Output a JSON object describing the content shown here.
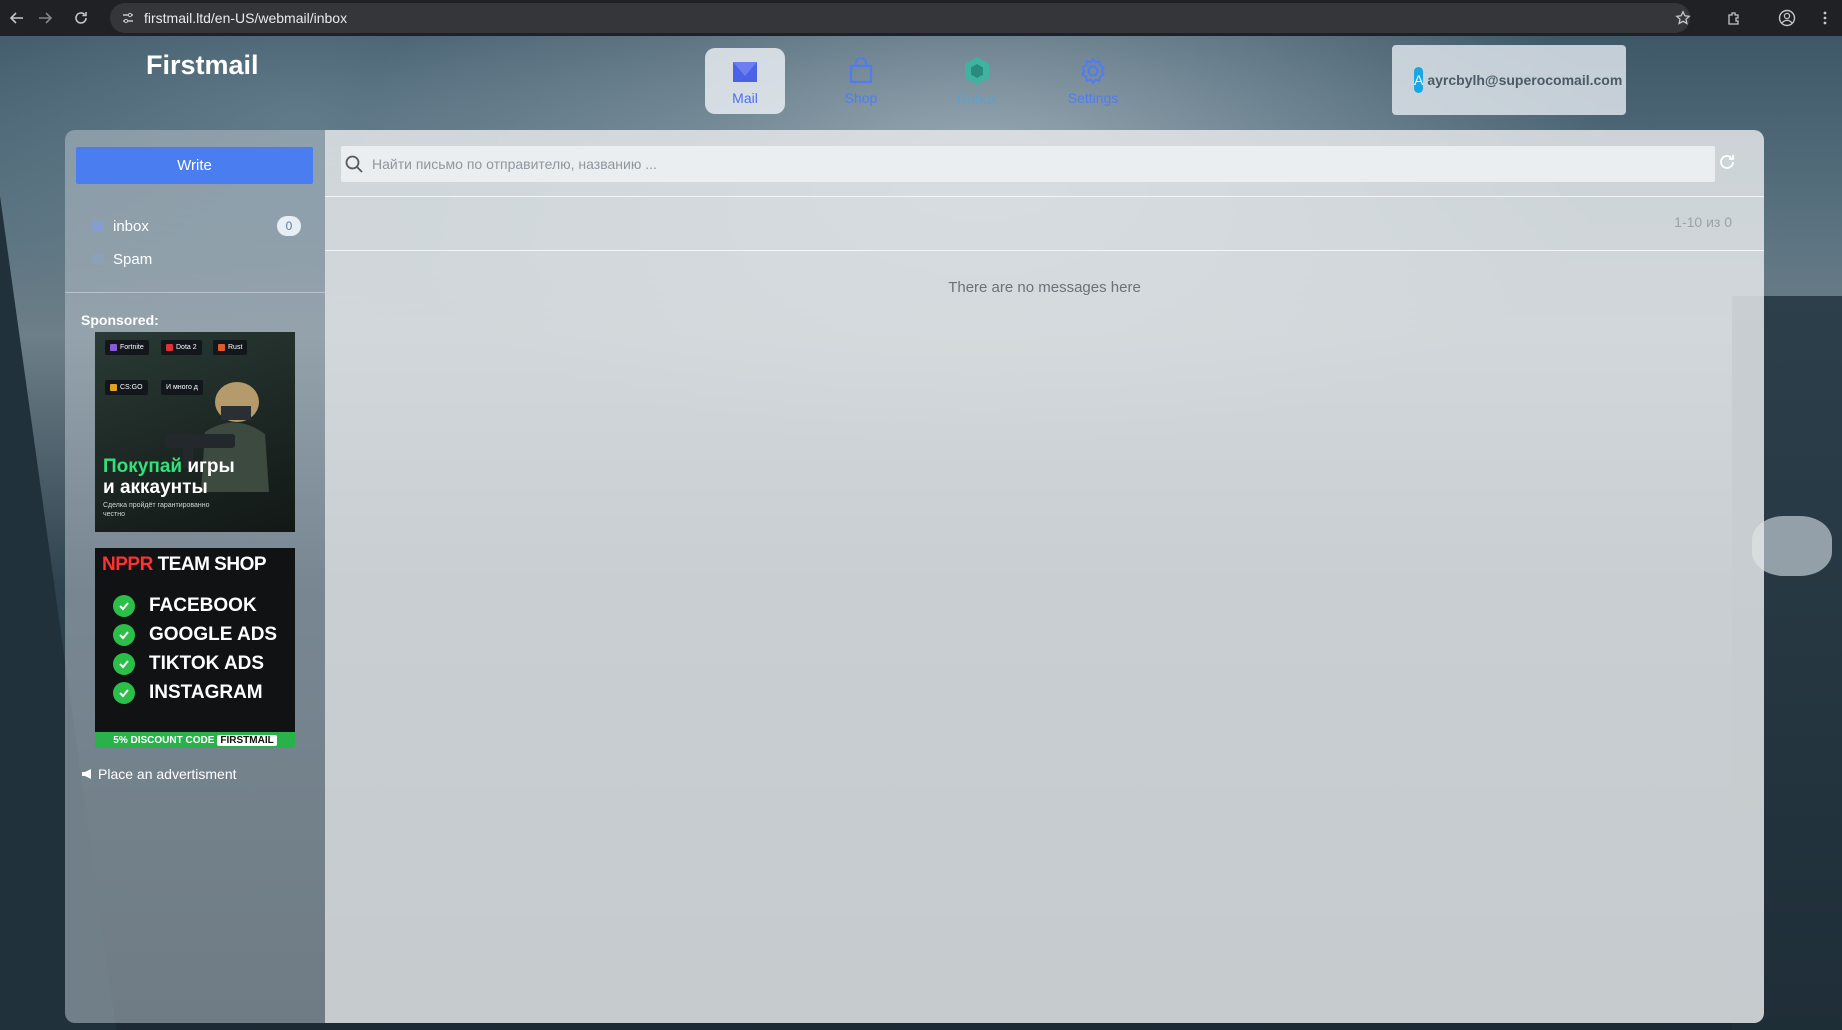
{
  "browser": {
    "url": "firstmail.ltd/en-US/webmail/inbox",
    "icons": [
      "back-icon",
      "forward-icon",
      "reload-icon",
      "site-info-icon",
      "star-icon",
      "extensions-icon",
      "profile-icon",
      "menu-icon"
    ]
  },
  "header": {
    "logo": "Firstmail",
    "nav": [
      {
        "label": "Mail",
        "icon": "mail-icon",
        "active": true
      },
      {
        "label": "Shop",
        "icon": "shop-icon"
      },
      {
        "label": "Robux",
        "icon": "robux-icon"
      },
      {
        "label": "Settings",
        "icon": "gear-icon"
      }
    ],
    "account": {
      "avatar_letter": "A",
      "email": "ayrcbylh@superocomail.com"
    }
  },
  "sidebar": {
    "write_label": "Write",
    "folders": [
      {
        "label": "inbox",
        "count": "0"
      },
      {
        "label": "Spam"
      }
    ],
    "sponsored_label": "Sponsored:",
    "ad1": {
      "chips": [
        "Fortnite",
        "Dota 2",
        "Rust",
        "CS:GO",
        "И много д"
      ],
      "headline_green": "Покупай",
      "headline_rest": " игры",
      "headline_line2": "и аккаунты",
      "sub": "Сделка пройдёт гарантированно честно"
    },
    "ad2": {
      "title_red": "NPPR",
      "title_rest": " TEAM SHOP",
      "items": [
        "FACEBOOK",
        "GOOGLE ADS",
        "TIKTOK ADS",
        "INSTAGRAM"
      ],
      "footer": "5% DISCOUNT CODE",
      "code": "FIRSTMAIL"
    },
    "place_ad_label": "Place an advertisment"
  },
  "main": {
    "search_placeholder": "Найти письмо по отправителю, названию ...",
    "pagination": "1-10 из 0",
    "empty_message": "There are no messages here"
  },
  "colors": {
    "accent": "#4a7df0",
    "avatar": "#19a5e6",
    "ad_green": "#34e07a",
    "ad_red": "#ff3131"
  }
}
